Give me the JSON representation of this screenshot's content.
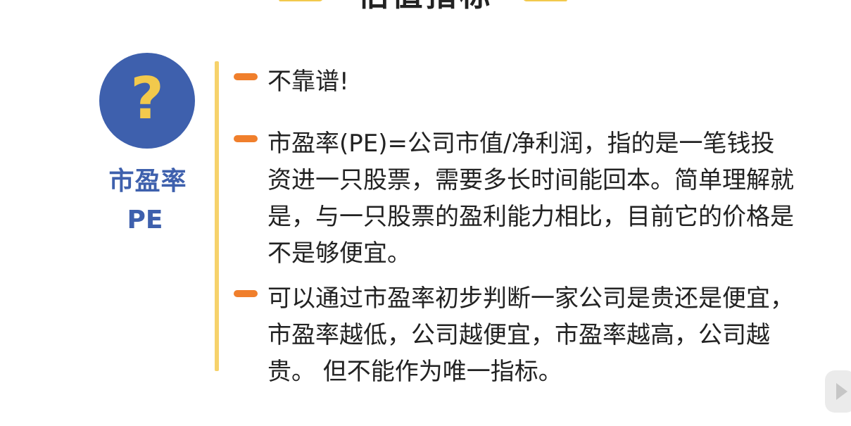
{
  "title": "估值指标",
  "icon": {
    "symbol": "?",
    "name": "question-mark-icon"
  },
  "label": {
    "cn": "市盈率",
    "en": "PE"
  },
  "bullets": [
    {
      "text": "不靠谱!"
    },
    {
      "text": "市盈率(PE)=公司市值/净利润，指的是一笔钱投资进一只股票，需要多长时间能回本。简单理解就是，与一只股票的盈利能力相比，目前它的价格是不是够便宜。"
    },
    {
      "text": "可以通过市盈率初步判断一家公司是贵还是便宜，市盈率越低，公司越便宜，市盈率越高，公司越贵。 但不能作为唯一指标。"
    }
  ],
  "colors": {
    "accent_blue": "#3e60ad",
    "accent_yellow": "#f2c94c",
    "accent_orange": "#f07f2c",
    "divider": "#f6d26b"
  }
}
